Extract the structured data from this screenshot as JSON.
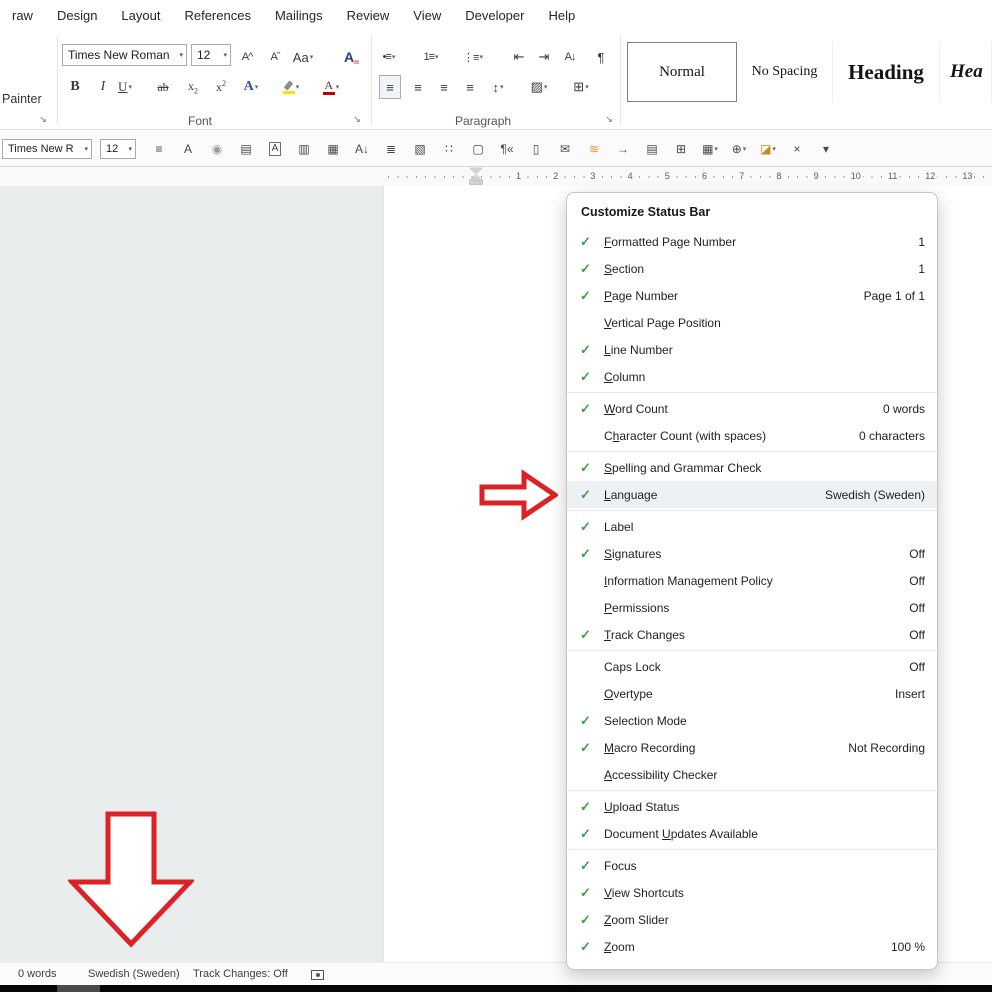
{
  "colors": {
    "arrow": "#dd2226",
    "check": "#3f9e49",
    "row_highlight": "#eef1f3"
  },
  "ui": {
    "dropdown_glyph": "▾",
    "launcher_glyph": "↘",
    "check_glyph": "✓"
  },
  "menubar": {
    "items": [
      "raw",
      "Design",
      "Layout",
      "References",
      "Mailings",
      "Review",
      "View",
      "Developer",
      "Help"
    ]
  },
  "ribbon": {
    "painter_label": "Painter",
    "font_group_label": "Font",
    "paragraph_group_label": "Paragraph",
    "font_name": "Times New Roman",
    "font_size": "12",
    "glyphs": {
      "grow": "A^",
      "shrink": "Aˇ",
      "case": "Aa",
      "clear": "A",
      "bold": "B",
      "italic": "I",
      "underline": "U",
      "strike": "ab",
      "sub": "x",
      "sub_s": "2",
      "sup": "x",
      "sup_s": "2",
      "effects": "A",
      "color": "A",
      "bullets": "•≡",
      "numbering": "1≡",
      "multilevel": "⋮≡",
      "outdent": "⇤",
      "indent": "⇥",
      "sort": "A↓",
      "pilcrow": "¶",
      "align": "≡",
      "spacing": "↕",
      "shading": "▨",
      "borders": "⊞"
    },
    "styles": [
      {
        "label": "Normal",
        "kind": "normal",
        "selected": true
      },
      {
        "label": "No Spacing",
        "kind": "nospacing"
      },
      {
        "label": "Heading",
        "kind": "h1"
      },
      {
        "label": "Hea",
        "kind": "h2"
      }
    ]
  },
  "toolbar2": {
    "font_name": "Times New R",
    "font_size": "12",
    "icons": [
      {
        "name": "line-paragraph-options-icon",
        "glyph": "≡"
      },
      {
        "name": "font-icon",
        "glyph": "A"
      },
      {
        "name": "record-circle-icon",
        "glyph": "◉",
        "color": "#9a9a9a"
      },
      {
        "name": "page-edit-icon",
        "glyph": "▤"
      },
      {
        "name": "boxed-font-icon",
        "glyph": "A",
        "boxed": true
      },
      {
        "name": "page-color-icon",
        "glyph": "▥"
      },
      {
        "name": "draw-table-icon",
        "glyph": "▦"
      },
      {
        "name": "sort-icon",
        "glyph": "A↓"
      },
      {
        "name": "line-numbers-icon",
        "glyph": "≣"
      },
      {
        "name": "page-font-icon",
        "glyph": "▧"
      },
      {
        "name": "list-settings-icon",
        "glyph": "∷"
      },
      {
        "name": "copy-page-icon",
        "glyph": "▢"
      },
      {
        "name": "pilcrow-back-icon",
        "glyph": "¶«"
      },
      {
        "name": "blank-page-icon",
        "glyph": "▯"
      },
      {
        "name": "envelope-icon",
        "glyph": "✉"
      },
      {
        "name": "highlight-rows-icon",
        "glyph": "≋",
        "color": "#e8942e"
      },
      {
        "name": "export-page-icon",
        "glyph": "→"
      },
      {
        "name": "document-lines-icon",
        "glyph": "▤"
      },
      {
        "name": "select-table-icon",
        "glyph": "⊞"
      },
      {
        "name": "table-icon",
        "glyph": "▦",
        "dropdown": true
      },
      {
        "name": "link-ring-icon",
        "glyph": "⊕",
        "dropdown": true
      },
      {
        "name": "fill-color-icon",
        "glyph": "◪",
        "color": "#c09016",
        "dropdown": true
      },
      {
        "name": "close-x-icon",
        "glyph": "×"
      },
      {
        "name": "more-options-icon",
        "glyph": "▾"
      }
    ]
  },
  "ruler": {
    "numbers": [
      "1",
      "2",
      "3",
      "4",
      "5",
      "6",
      "7",
      "8",
      "9",
      "10",
      "11",
      "12",
      "13"
    ]
  },
  "menu": {
    "title": "Customize Status Bar",
    "items": [
      {
        "label": "Formatted Page Number",
        "checked": true,
        "value": "1",
        "accel": 0
      },
      {
        "label": "Section",
        "checked": true,
        "value": "1",
        "accel": 0
      },
      {
        "label": "Page Number",
        "checked": true,
        "value": "Page 1 of 1",
        "accel": 0
      },
      {
        "label": "Vertical Page Position",
        "checked": false,
        "value": "",
        "accel": 0
      },
      {
        "label": "Line Number",
        "checked": true,
        "value": "",
        "accel": 0
      },
      {
        "label": "Column",
        "checked": true,
        "value": "",
        "accel": 0,
        "sep_after": true
      },
      {
        "label": "Word Count",
        "checked": true,
        "value": "0 words",
        "accel": 0
      },
      {
        "label": "Character Count (with spaces)",
        "checked": false,
        "value": "0 characters",
        "accel": 1,
        "sep_after": true
      },
      {
        "label": "Spelling and Grammar Check",
        "checked": true,
        "value": "",
        "accel": 0
      },
      {
        "label": "Language",
        "checked": true,
        "value": "Swedish (Sweden)",
        "accel": 0,
        "highlighted": true,
        "sep_after": true
      },
      {
        "label": "Label",
        "checked": true,
        "value": ""
      },
      {
        "label": "Signatures",
        "checked": true,
        "value": "Off",
        "accel": 0
      },
      {
        "label": "Information Management Policy",
        "checked": false,
        "value": "Off",
        "accel": 0
      },
      {
        "label": "Permissions",
        "checked": false,
        "value": "Off",
        "accel": 0
      },
      {
        "label": "Track Changes",
        "checked": true,
        "value": "Off",
        "accel": 0,
        "sep_after": true
      },
      {
        "label": "Caps Lock",
        "checked": false,
        "value": "Off"
      },
      {
        "label": "Overtype",
        "checked": false,
        "value": "Insert",
        "accel": 0
      },
      {
        "label": "Selection Mode",
        "checked": true,
        "value": ""
      },
      {
        "label": "Macro Recording",
        "checked": true,
        "value": "Not Recording",
        "accel": 0
      },
      {
        "label": "Accessibility Checker",
        "checked": false,
        "value": "",
        "accel": 0,
        "sep_after": true
      },
      {
        "label": "Upload Status",
        "checked": true,
        "value": "",
        "accel": 0
      },
      {
        "label": "Document Updates Available",
        "checked": true,
        "value": "",
        "accel": 9,
        "sep_after": true
      },
      {
        "label": "Focus",
        "checked": true,
        "value": ""
      },
      {
        "label": "View Shortcuts",
        "checked": true,
        "value": "",
        "accel": 0
      },
      {
        "label": "Zoom Slider",
        "checked": true,
        "value": "",
        "accel": 0
      },
      {
        "label": "Zoom",
        "checked": true,
        "value": "100 %",
        "accel": 0
      }
    ]
  },
  "statusbar": {
    "word_count": "0 words",
    "language": "Swedish (Sweden)",
    "track_changes": "Track Changes: Off"
  }
}
